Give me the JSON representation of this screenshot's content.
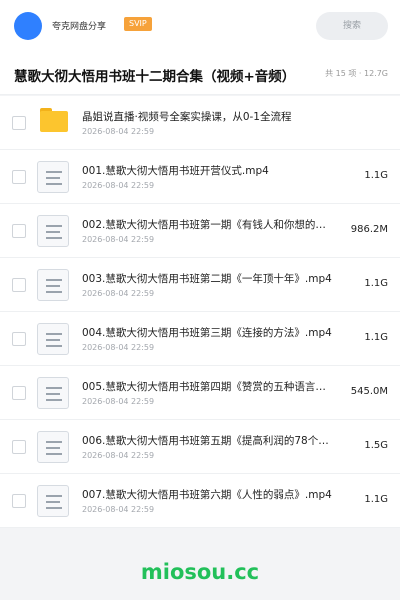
{
  "header": {
    "user_name": "夸克网盘分享",
    "vip_label": "SVIP",
    "search_label": "搜索"
  },
  "page": {
    "title": "慧歌大彻大悟用书班十二期合集（视频+音频）",
    "summary": "共 15 项 · 12.7G"
  },
  "files": [
    {
      "name": "晶姐说直播·视频号全案实操课，从0-1全流程",
      "date": "2026-08-04 22:59",
      "size": "",
      "type": "folder"
    },
    {
      "name": "001.慧歌大彻大悟用书班开营仪式.mp4",
      "date": "2026-08-04 22:59",
      "size": "1.1G",
      "type": "file"
    },
    {
      "name": "002.慧歌大彻大悟用书班第一期《有钱人和你想的不一样》.mp4",
      "date": "2026-08-04 22:59",
      "size": "986.2M",
      "type": "file"
    },
    {
      "name": "003.慧歌大彻大悟用书班第二期《一年顶十年》.mp4",
      "date": "2026-08-04 22:59",
      "size": "1.1G",
      "type": "file"
    },
    {
      "name": "004.慧歌大彻大悟用书班第三期《连接的方法》.mp4",
      "date": "2026-08-04 22:59",
      "size": "1.1G",
      "type": "file"
    },
    {
      "name": "005.慧歌大彻大悟用书班第四期《赞赏的五种语言》.mp4",
      "date": "2026-08-04 22:59",
      "size": "545.0M",
      "type": "file"
    },
    {
      "name": "006.慧歌大彻大悟用书班第五期《提高利润的78个方法》.mp4",
      "date": "2026-08-04 22:59",
      "size": "1.5G",
      "type": "file"
    },
    {
      "name": "007.慧歌大彻大悟用书班第六期《人性的弱点》.mp4",
      "date": "2026-08-04 22:59",
      "size": "1.1G",
      "type": "file"
    }
  ],
  "watermark": "miosou.cc",
  "colors": {
    "accent": "#2f80ff",
    "vip": "#f6a23a",
    "folder": "#fcc52e",
    "watermark": "#22c05a"
  }
}
